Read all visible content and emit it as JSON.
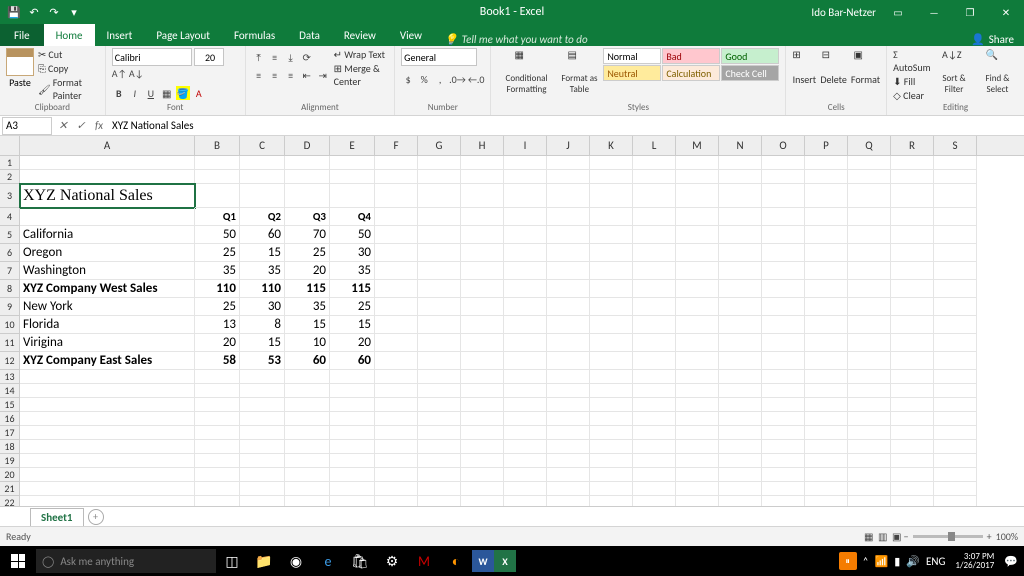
{
  "app": {
    "title": "Book1 - Excel",
    "user": "Ido Bar-Netzer"
  },
  "tabs": {
    "file": "File",
    "home": "Home",
    "insert": "Insert",
    "page_layout": "Page Layout",
    "formulas": "Formulas",
    "data": "Data",
    "review": "Review",
    "view": "View",
    "tell_me": "Tell me what you want to do",
    "share": "Share"
  },
  "ribbon": {
    "clipboard": {
      "label": "Clipboard",
      "paste": "Paste",
      "cut": "Cut",
      "copy": "Copy",
      "format_painter": "Format Painter"
    },
    "font": {
      "label": "Font",
      "name": "Calibri",
      "size": "20"
    },
    "alignment": {
      "label": "Alignment",
      "wrap": "Wrap Text",
      "merge": "Merge & Center"
    },
    "number": {
      "label": "Number",
      "format": "General"
    },
    "styles": {
      "label": "Styles",
      "cond": "Conditional Formatting",
      "fat": "Format as Table",
      "normal": "Normal",
      "bad": "Bad",
      "good": "Good",
      "neutral": "Neutral",
      "calc": "Calculation",
      "check": "Check Cell"
    },
    "cells": {
      "label": "Cells",
      "insert": "Insert",
      "delete": "Delete",
      "format": "Format"
    },
    "editing": {
      "label": "Editing",
      "autosum": "AutoSum",
      "fill": "Fill",
      "clear": "Clear",
      "sort": "Sort & Filter",
      "find": "Find & Select"
    }
  },
  "formula_bar": {
    "name_box": "A3",
    "formula": "XYZ National Sales"
  },
  "chart_data": {
    "type": "table",
    "title": "XYZ National Sales",
    "columns": [
      "Q1",
      "Q2",
      "Q3",
      "Q4"
    ],
    "rows": [
      {
        "label": "California",
        "values": [
          50,
          60,
          70,
          50
        ],
        "bold": false
      },
      {
        "label": "Oregon",
        "values": [
          25,
          15,
          25,
          30
        ],
        "bold": false
      },
      {
        "label": "Washington",
        "values": [
          35,
          35,
          20,
          35
        ],
        "bold": false
      },
      {
        "label": "XYZ Company West Sales",
        "values": [
          110,
          110,
          115,
          115
        ],
        "bold": true
      },
      {
        "label": "New York",
        "values": [
          25,
          30,
          35,
          25
        ],
        "bold": false
      },
      {
        "label": "Florida",
        "values": [
          13,
          8,
          15,
          15
        ],
        "bold": false
      },
      {
        "label": "Virigina",
        "values": [
          20,
          15,
          10,
          20
        ],
        "bold": false
      },
      {
        "label": "XYZ Company East Sales",
        "values": [
          58,
          53,
          60,
          60
        ],
        "bold": true
      }
    ]
  },
  "sheet": {
    "tab": "Sheet1",
    "selected_cell": "A3"
  },
  "status": {
    "ready": "Ready",
    "zoom": "100%"
  },
  "taskbar": {
    "search_placeholder": "Ask me anything",
    "time": "3:07 PM",
    "date": "1/26/2017"
  }
}
